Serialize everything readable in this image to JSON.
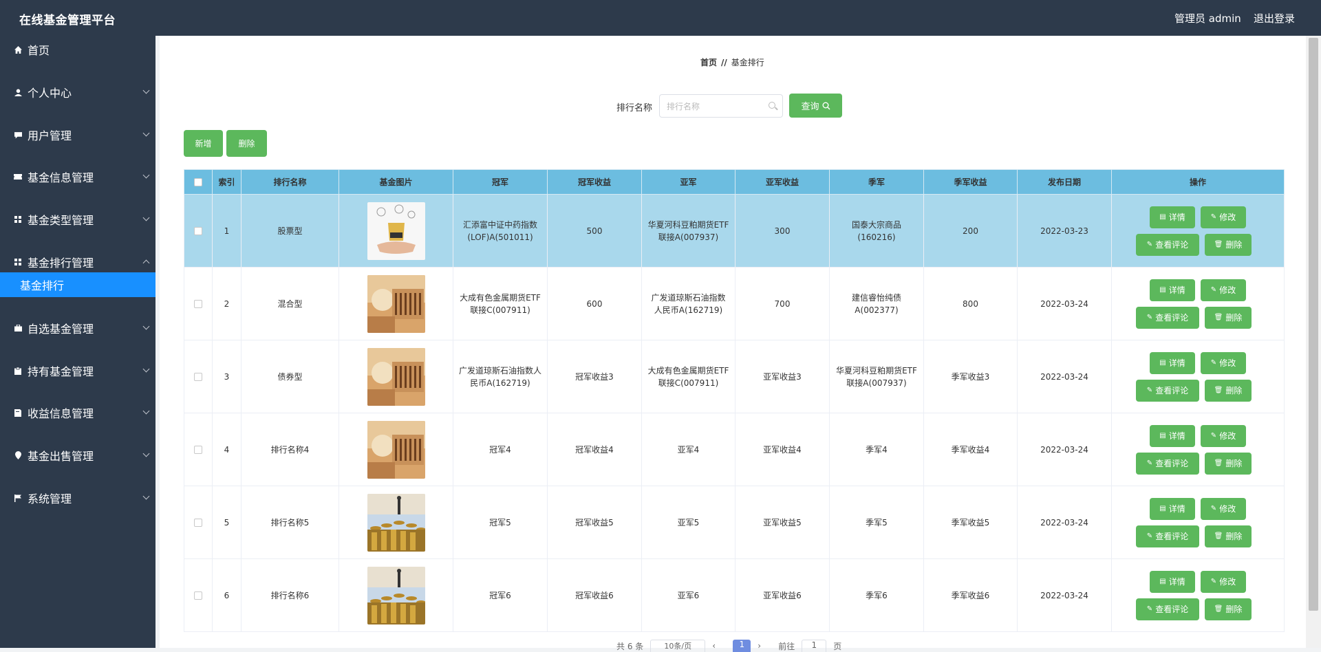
{
  "app": {
    "title": "在线基金管理平台",
    "user": "管理员 admin",
    "logout": "退出登录"
  },
  "sidebar": {
    "items": [
      {
        "label": "首页",
        "icon": "home-icon"
      },
      {
        "label": "个人中心",
        "icon": "user-icon"
      },
      {
        "label": "用户管理",
        "icon": "comment-icon"
      },
      {
        "label": "基金信息管理",
        "icon": "ticket-icon"
      },
      {
        "label": "基金类型管理",
        "icon": "grid-icon"
      },
      {
        "label": "基金排行管理",
        "icon": "grid-icon"
      },
      {
        "label": "自选基金管理",
        "icon": "briefcase-icon"
      },
      {
        "label": "持有基金管理",
        "icon": "clipboard-icon"
      },
      {
        "label": "收益信息管理",
        "icon": "book-icon"
      },
      {
        "label": "基金出售管理",
        "icon": "pin-icon"
      },
      {
        "label": "系统管理",
        "icon": "flag-icon"
      }
    ],
    "active_sub": "基金排行"
  },
  "breadcrumb": {
    "home": "首页",
    "sep": "//",
    "current": "基金排行"
  },
  "search": {
    "label": "排行名称",
    "placeholder": "排行名称",
    "button": "查询"
  },
  "toolbar": {
    "add": "新增",
    "delete": "删除"
  },
  "table": {
    "headers": [
      "索引",
      "排行名称",
      "基金图片",
      "冠军",
      "冠军收益",
      "亚军",
      "亚军收益",
      "季军",
      "季军收益",
      "发布日期",
      "操作"
    ],
    "rows": [
      {
        "index": "1",
        "name": "股票型",
        "champion": "汇添富中证中药指数(LOF)A(501011)",
        "champion_gain": "500",
        "runner": "华夏河科豆粕期货ETF联接A(007937)",
        "runner_gain": "300",
        "third": "国泰大宗商品(160216)",
        "third_gain": "200",
        "date": "2022-03-23"
      },
      {
        "index": "2",
        "name": "混合型",
        "champion": "大成有色金属期货ETF联接C(007911)",
        "champion_gain": "600",
        "runner": "广发道琼斯石油指数人民币A(162719)",
        "runner_gain": "700",
        "third": "建信睿怡纯债A(002377)",
        "third_gain": "800",
        "date": "2022-03-24"
      },
      {
        "index": "3",
        "name": "债券型",
        "champion": "广发道琼斯石油指数人民币A(162719)",
        "champion_gain": "冠军收益3",
        "runner": "大成有色金属期货ETF联接C(007911)",
        "runner_gain": "亚军收益3",
        "third": "华夏河科豆粕期货ETF联接A(007937)",
        "third_gain": "季军收益3",
        "date": "2022-03-24"
      },
      {
        "index": "4",
        "name": "排行名称4",
        "champion": "冠军4",
        "champion_gain": "冠军收益4",
        "runner": "亚军4",
        "runner_gain": "亚军收益4",
        "third": "季军4",
        "third_gain": "季军收益4",
        "date": "2022-03-24"
      },
      {
        "index": "5",
        "name": "排行名称5",
        "champion": "冠军5",
        "champion_gain": "冠军收益5",
        "runner": "亚军5",
        "runner_gain": "亚军收益5",
        "third": "季军5",
        "third_gain": "季军收益5",
        "date": "2022-03-24"
      },
      {
        "index": "6",
        "name": "排行名称6",
        "champion": "冠军6",
        "champion_gain": "冠军收益6",
        "runner": "亚军6",
        "runner_gain": "亚军收益6",
        "third": "季军6",
        "third_gain": "季军收益6",
        "date": "2022-03-24"
      }
    ],
    "actions": {
      "detail": "详情",
      "edit": "修改",
      "comments": "查看评论",
      "delete": "删除"
    }
  },
  "pager": {
    "total": "共 6 条",
    "page_size": "10条/页",
    "current_page": "1",
    "goto": "前往",
    "page_unit": "页"
  },
  "colors": {
    "header_bg": "#2d3a4b",
    "active": "#1890ff",
    "button": "#5cb85c",
    "table_header": "#6cbde0",
    "row_highlight": "#a9d8ec"
  }
}
